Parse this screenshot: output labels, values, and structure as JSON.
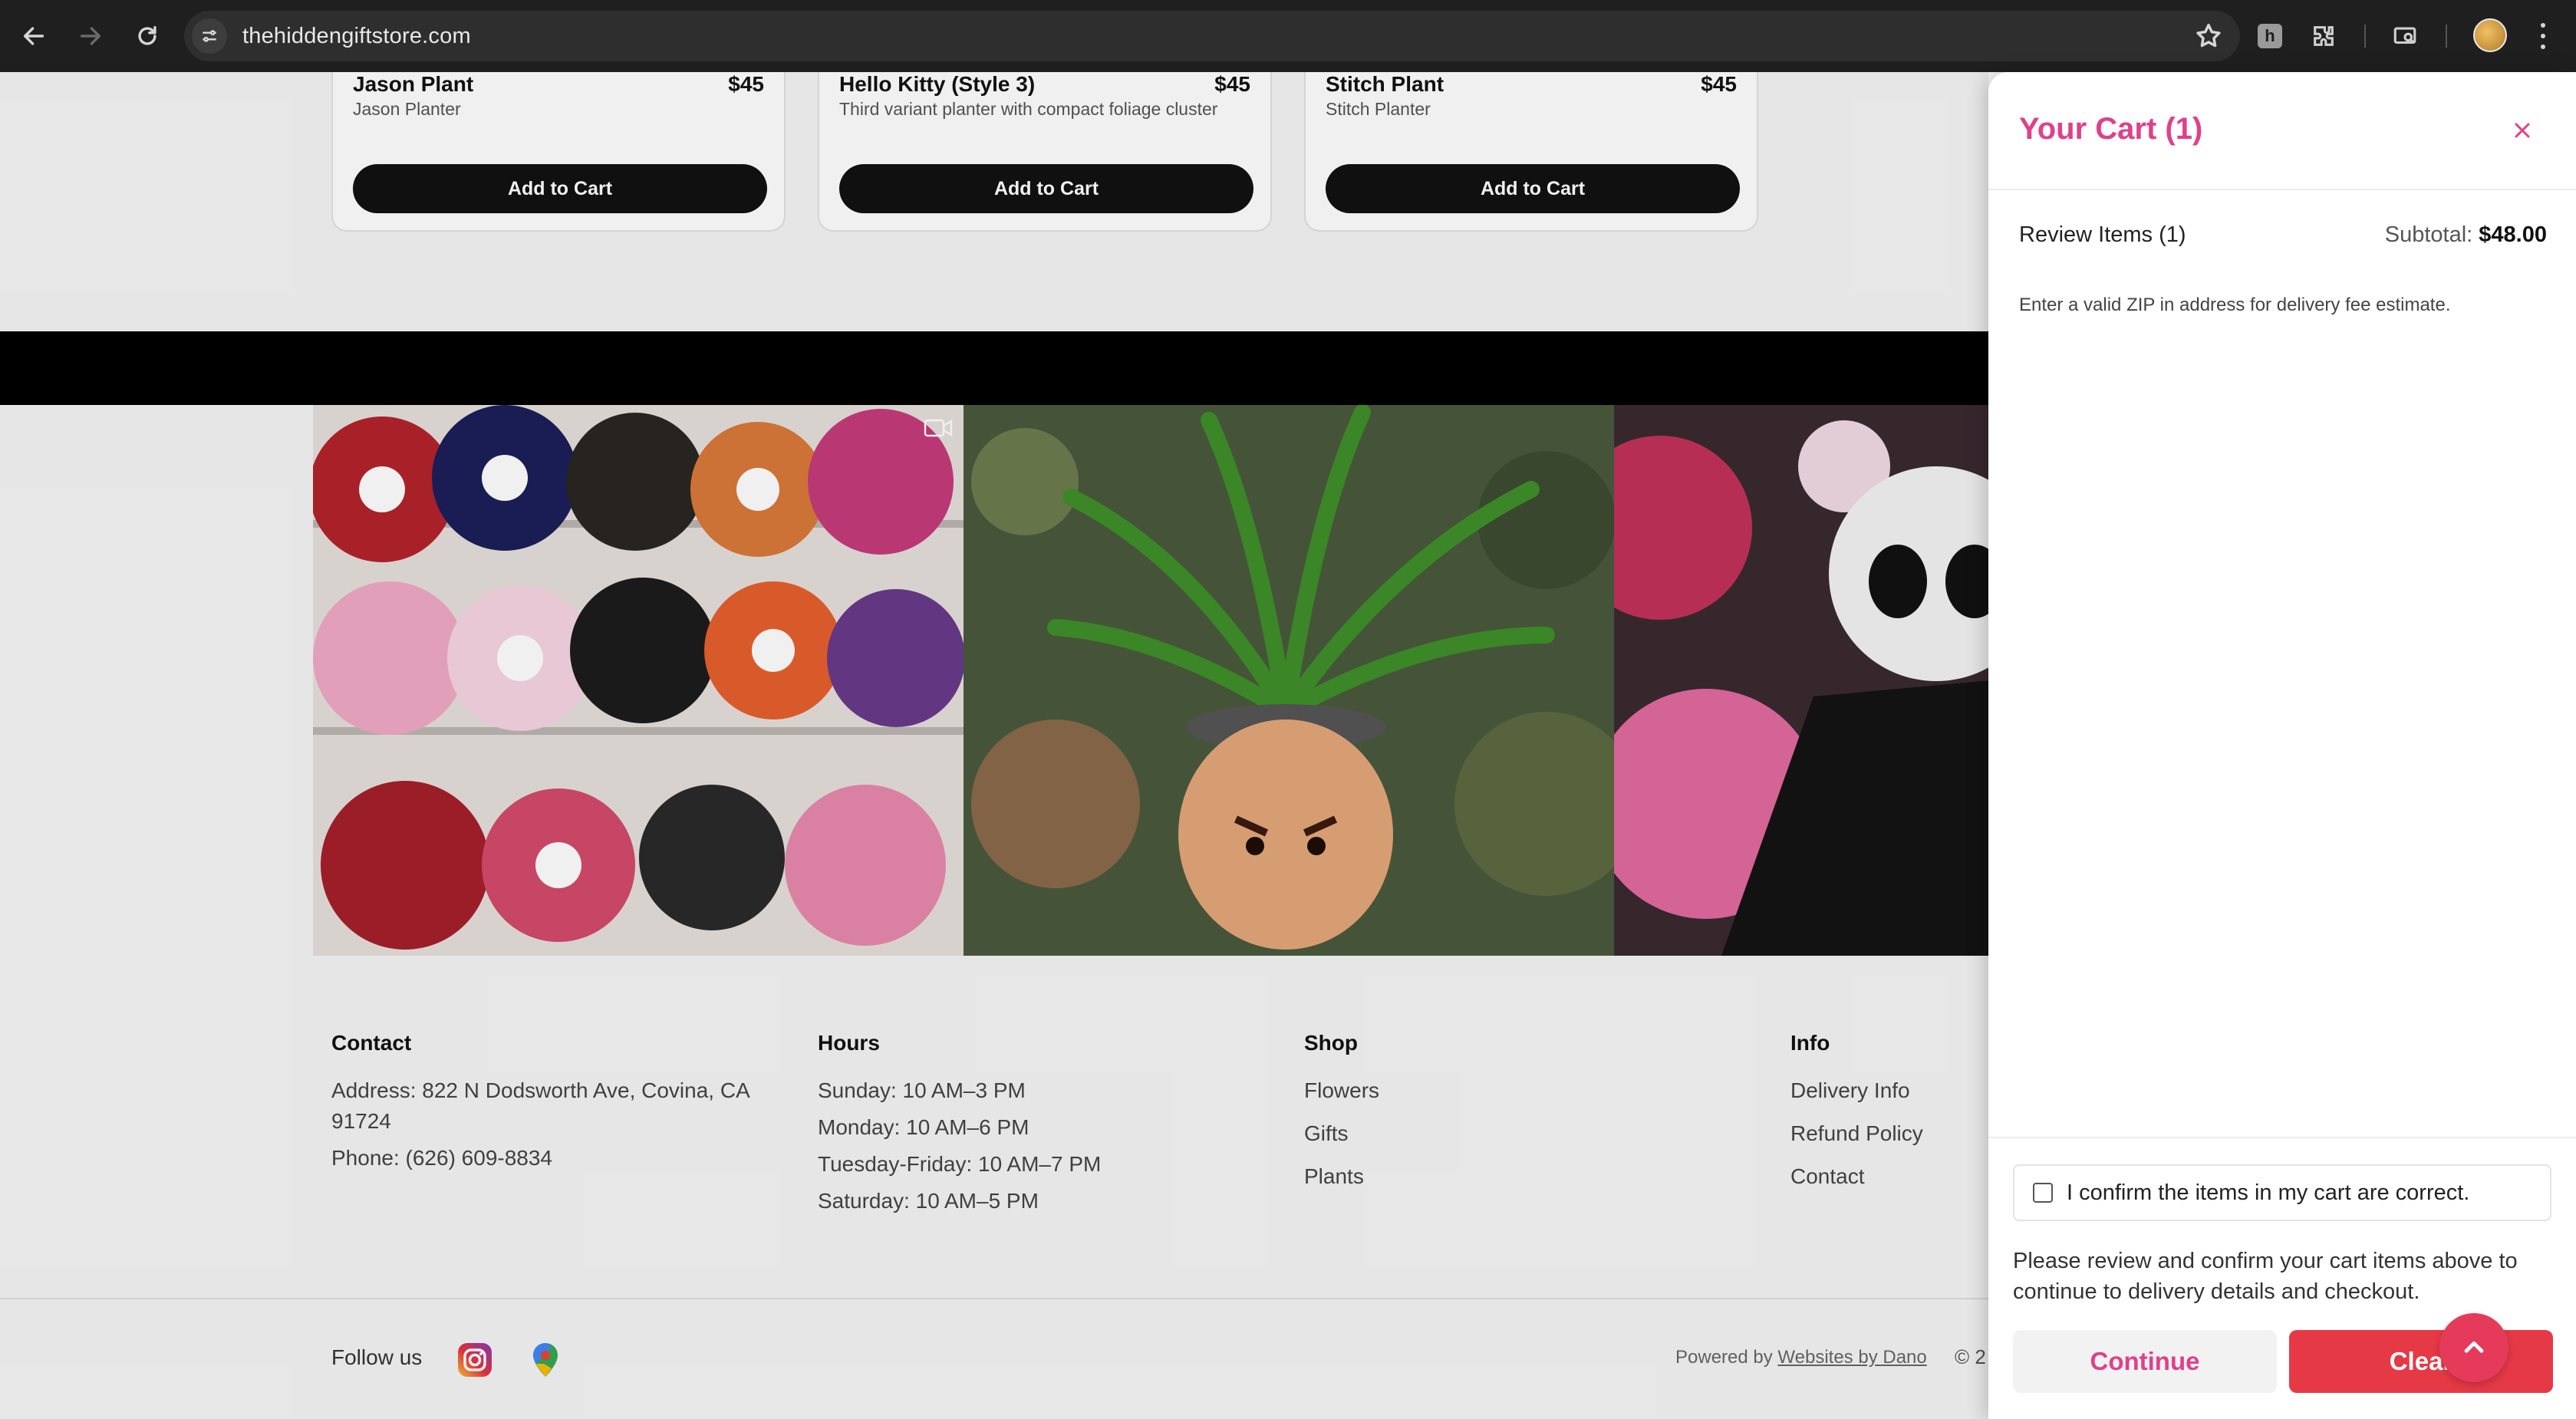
{
  "browser": {
    "url": "thehiddengiftstore.com",
    "extension_letter": "h"
  },
  "products": [
    {
      "name": "Jason Plant",
      "price": "$45",
      "description": "Jason Planter",
      "button": "Add to Cart"
    },
    {
      "name": "Hello Kitty (Style 3)",
      "price": "$45",
      "description": "Third variant planter with compact foliage cluster",
      "button": "Add to Cart"
    },
    {
      "name": "Stitch Plant",
      "price": "$45",
      "description": "Stitch Planter",
      "button": "Add to Cart"
    }
  ],
  "footer": {
    "contact": {
      "heading": "Contact",
      "address": "Address: 822 N Dodsworth Ave, Covina, CA 91724",
      "phone": "Phone: (626) 609-8834"
    },
    "hours": {
      "heading": "Hours",
      "lines": [
        "Sunday: 10 AM–3 PM",
        "Monday: 10 AM–6 PM",
        "Tuesday-Friday: 10 AM–7 PM",
        "Saturday: 10 AM–5 PM"
      ]
    },
    "shop": {
      "heading": "Shop",
      "links": [
        "Flowers",
        "Gifts",
        "Plants"
      ]
    },
    "info": {
      "heading": "Info",
      "links": [
        "Delivery Info",
        "Refund Policy",
        "Contact"
      ]
    },
    "follow_label": "Follow us",
    "powered_prefix": "Powered by",
    "powered_link": "Websites by Dano",
    "copyright": "© 2"
  },
  "cart": {
    "title": "Your Cart (1)",
    "review_label": "Review Items (1)",
    "subtotal_label": "Subtotal:",
    "subtotal_value": "$48.00",
    "zip_note": "Enter a valid ZIP in address for delivery fee estimate.",
    "confirm_label": "I confirm the items in my cart are correct.",
    "confirm_checked": false,
    "help_text": "Please review and confirm your cart items above to continue to delivery details and checkout.",
    "continue_label": "Continue",
    "clear_label": "Clear"
  },
  "colors": {
    "accent_pink": "#e0408a",
    "clear_red": "#e63946",
    "scroll_top": "#e63a5a"
  }
}
